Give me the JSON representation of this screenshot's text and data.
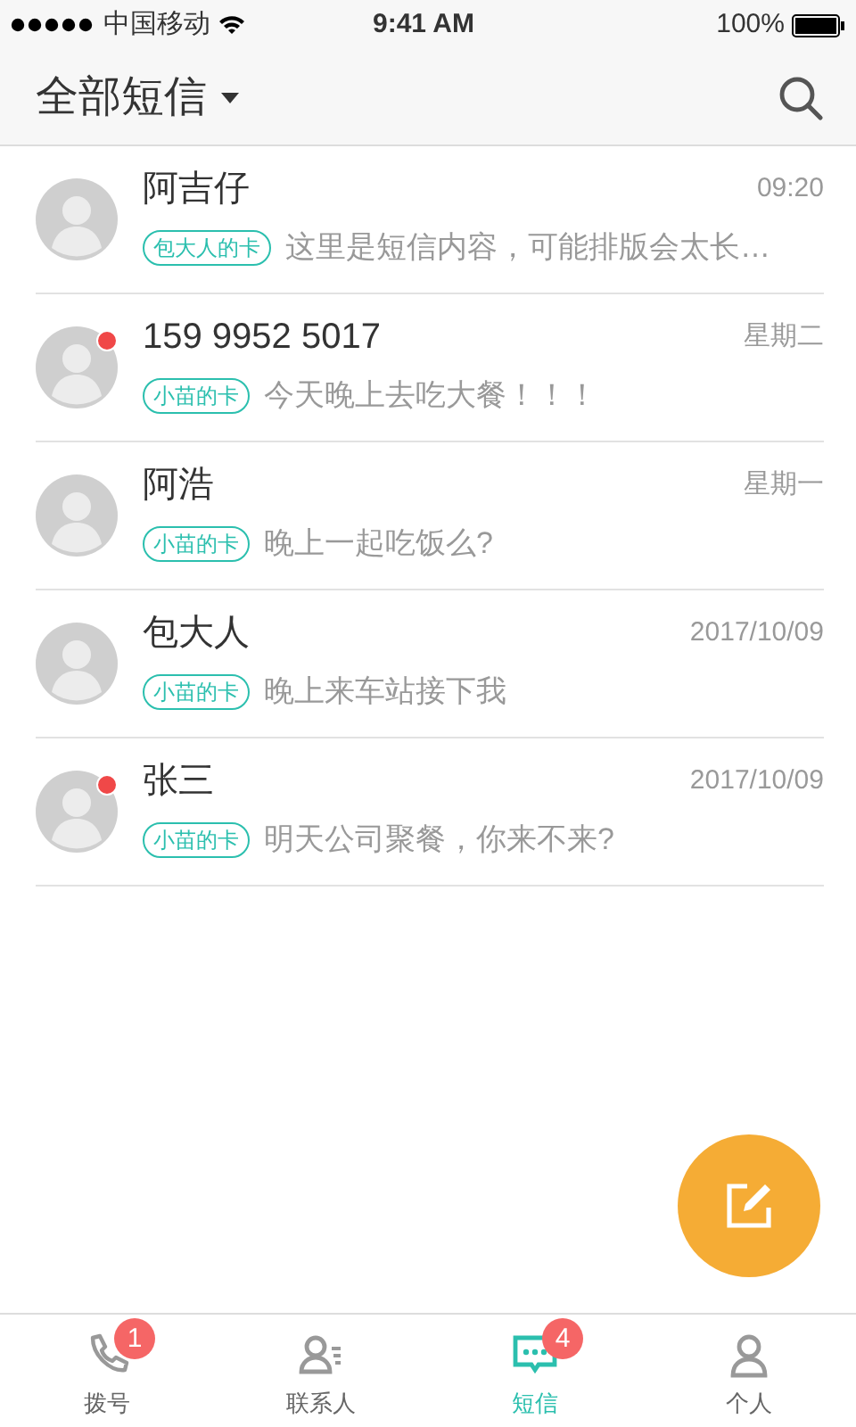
{
  "status_bar": {
    "carrier": "中国移动",
    "time": "9:41 AM",
    "battery": "100%"
  },
  "header": {
    "title": "全部短信"
  },
  "messages": [
    {
      "name": "阿吉仔",
      "time": "09:20",
      "card": "包大人的卡",
      "text": "这里是短信内容，可能排版会太长…",
      "unread": false
    },
    {
      "name": "159 9952 5017",
      "time": "星期二",
      "card": "小苗的卡",
      "text": "今天晚上去吃大餐！！！",
      "unread": true
    },
    {
      "name": "阿浩",
      "time": "星期一",
      "card": "小苗的卡",
      "text": "晚上一起吃饭么?",
      "unread": false
    },
    {
      "name": "包大人",
      "time": "2017/10/09",
      "card": "小苗的卡",
      "text": "晚上来车站接下我",
      "unread": false
    },
    {
      "name": "张三",
      "time": "2017/10/09",
      "card": "小苗的卡",
      "text": "明天公司聚餐，你来不来?",
      "unread": true
    }
  ],
  "tabs": [
    {
      "kind": "phone",
      "label": "拨号",
      "badge": "1",
      "selected": false
    },
    {
      "kind": "contacts",
      "label": "联系人",
      "selected": false
    },
    {
      "kind": "sms",
      "label": "短信",
      "badge": "4",
      "selected": true
    },
    {
      "kind": "person",
      "label": "个人",
      "selected": false
    }
  ]
}
